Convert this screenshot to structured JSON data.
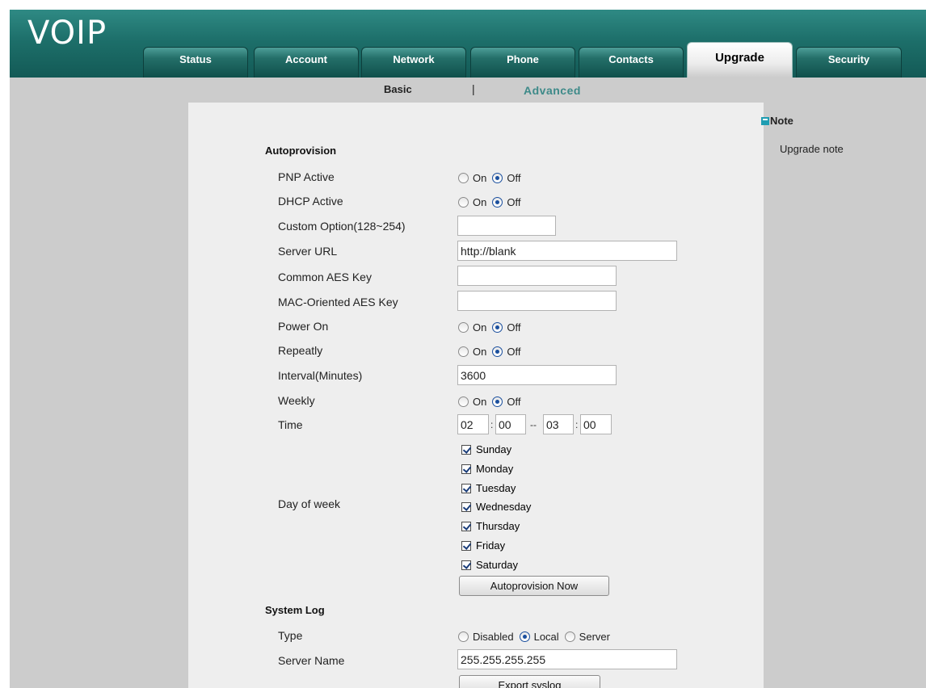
{
  "header": {
    "logo": "VOIP",
    "tabs": [
      {
        "label": "Status"
      },
      {
        "label": "Account"
      },
      {
        "label": "Network"
      },
      {
        "label": "Phone"
      },
      {
        "label": "Contacts"
      },
      {
        "label": "Upgrade",
        "active": true
      },
      {
        "label": "Security"
      }
    ]
  },
  "subnav": {
    "basic": "Basic",
    "separator": "|",
    "advanced": "Advanced"
  },
  "autoprovision": {
    "title": "Autoprovision",
    "pnp_active": {
      "label": "PNP Active",
      "on": "On",
      "off": "Off",
      "value": "Off"
    },
    "dhcp_active": {
      "label": "DHCP Active",
      "on": "On",
      "off": "Off",
      "value": "Off"
    },
    "custom_option": {
      "label": "Custom Option(128~254)",
      "value": ""
    },
    "server_url": {
      "label": "Server URL",
      "value": "http://blank"
    },
    "common_aes_key": {
      "label": "Common AES Key",
      "value": ""
    },
    "mac_aes_key": {
      "label": "MAC-Oriented AES Key",
      "value": ""
    },
    "power_on": {
      "label": "Power On",
      "on": "On",
      "off": "Off",
      "value": "Off"
    },
    "repeatly": {
      "label": "Repeatly",
      "on": "On",
      "off": "Off",
      "value": "Off"
    },
    "interval": {
      "label": "Interval(Minutes)",
      "value": "3600"
    },
    "weekly": {
      "label": "Weekly",
      "on": "On",
      "off": "Off",
      "value": "Off"
    },
    "time": {
      "label": "Time",
      "start_hour": "02",
      "start_min": "00",
      "end_hour": "03",
      "end_min": "00",
      "colon": ":",
      "dash": "--"
    },
    "day_of_week": {
      "label": "Day of week",
      "days": [
        {
          "label": "Sunday",
          "checked": true
        },
        {
          "label": "Monday",
          "checked": true
        },
        {
          "label": "Tuesday",
          "checked": true
        },
        {
          "label": "Wednesday",
          "checked": true
        },
        {
          "label": "Thursday",
          "checked": true
        },
        {
          "label": "Friday",
          "checked": true
        },
        {
          "label": "Saturday",
          "checked": true
        }
      ]
    },
    "button": "Autoprovision Now"
  },
  "system_log": {
    "title": "System Log",
    "type": {
      "label": "Type",
      "disabled": "Disabled",
      "local": "Local",
      "server": "Server",
      "value": "Local"
    },
    "server_name": {
      "label": "Server Name",
      "value": "255.255.255.255"
    },
    "button": "Export syslog"
  },
  "note": {
    "title": "Note",
    "text": "Upgrade note"
  }
}
